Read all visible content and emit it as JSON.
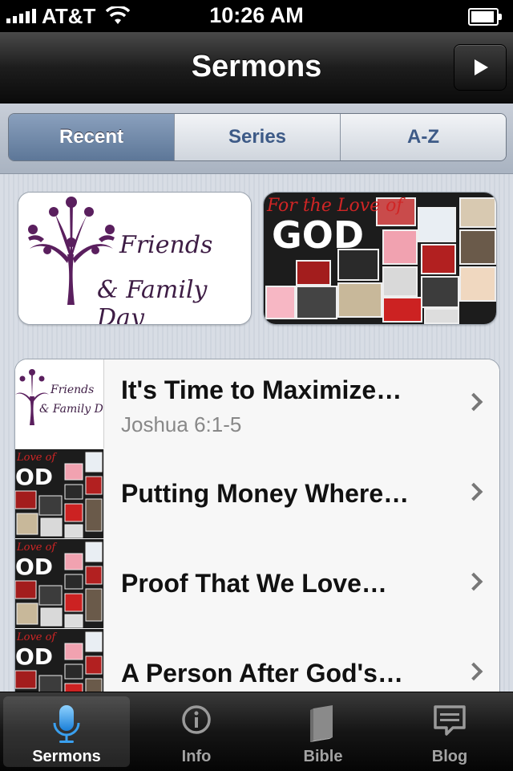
{
  "status_bar": {
    "carrier": "AT&T",
    "time": "10:26 AM"
  },
  "nav": {
    "title": "Sermons",
    "play_icon": "play-icon"
  },
  "segments": [
    {
      "label": "Recent",
      "active": true
    },
    {
      "label": "Series",
      "active": false
    },
    {
      "label": "A-Z",
      "active": false
    }
  ],
  "featured": [
    {
      "line1": "Friends",
      "line2": "& Family Day"
    },
    {
      "line1": "For the Love of",
      "line2": "GOD"
    }
  ],
  "sermons": [
    {
      "title": "It's Time to Maximize…",
      "subtitle": "Joshua 6:1-5",
      "art": "friends-family"
    },
    {
      "title": "Putting Money Where…",
      "subtitle": "",
      "art": "love-of-god"
    },
    {
      "title": "Proof That We Love…",
      "subtitle": "",
      "art": "love-of-god"
    },
    {
      "title": "A Person After God's…",
      "subtitle": "",
      "art": "love-of-god"
    }
  ],
  "tabs": [
    {
      "label": "Sermons",
      "icon": "microphone-icon",
      "active": true
    },
    {
      "label": "Info",
      "icon": "info-icon",
      "active": false
    },
    {
      "label": "Bible",
      "icon": "book-icon",
      "active": false
    },
    {
      "label": "Blog",
      "icon": "speech-bubble-icon",
      "active": false
    }
  ],
  "colors": {
    "accent_blue": "#5d7798",
    "segment_text": "#3d5a87",
    "ff_purple": "#5a1f5e",
    "god_red": "#d02525"
  }
}
